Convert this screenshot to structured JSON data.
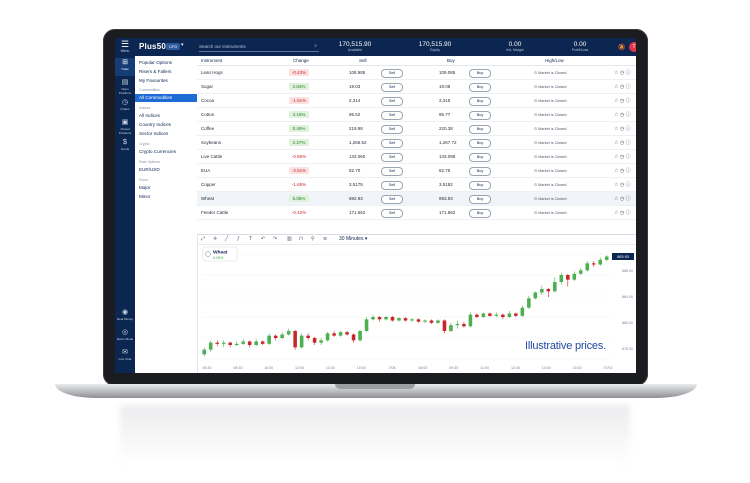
{
  "app": {
    "logo": "Plus500",
    "mode": "CFD",
    "menu_label": "Menu",
    "search_placeholder": "Search our Instruments",
    "stats": [
      {
        "value": "170,515.90",
        "label": "Available"
      },
      {
        "value": "170,515.90",
        "label": "Equity"
      },
      {
        "value": "0.00",
        "label": "Init. Margin"
      },
      {
        "value": "0.00",
        "label": "Profit/Loss"
      }
    ],
    "avatar_initial": "T"
  },
  "left_nav": [
    {
      "icon": "trade-icon",
      "label": "Trade",
      "glyph": "⊞",
      "active": true
    },
    {
      "icon": "open-positions-icon",
      "label": "Open Positions",
      "glyph": "▤",
      "active": false
    },
    {
      "icon": "orders-icon",
      "label": "Orders",
      "glyph": "◷",
      "active": false
    },
    {
      "icon": "closed-positions-icon",
      "label": "Closed Positions",
      "glyph": "▣",
      "active": false
    },
    {
      "icon": "funds-icon",
      "label": "Funds",
      "glyph": "$",
      "active": false
    }
  ],
  "left_nav_bottom": [
    {
      "icon": "real-money-icon",
      "label": "Real Money"
    },
    {
      "icon": "demo-mode-icon",
      "label": "Demo Mode"
    },
    {
      "icon": "live-chat-icon",
      "label": "Live Chat"
    }
  ],
  "categories": [
    {
      "label": "Popular Options",
      "type": "item"
    },
    {
      "label": "Risers & Fallers",
      "type": "item"
    },
    {
      "label": "My Favourites",
      "type": "item"
    },
    {
      "label": "Commodities",
      "type": "group"
    },
    {
      "label": "All Commodities",
      "type": "selected"
    },
    {
      "label": "Indices",
      "type": "group"
    },
    {
      "label": "All Indices",
      "type": "item"
    },
    {
      "label": "Country Indices",
      "type": "item"
    },
    {
      "label": "Sector Indices",
      "type": "item"
    },
    {
      "label": "Crypto",
      "type": "group"
    },
    {
      "label": "Crypto Currencies",
      "type": "item"
    },
    {
      "label": "Rate Options",
      "type": "group"
    },
    {
      "label": "EUR/USD",
      "type": "item"
    },
    {
      "label": "Forex",
      "type": "group"
    },
    {
      "label": "Major",
      "type": "item"
    },
    {
      "label": "Minor",
      "type": "item"
    }
  ],
  "table": {
    "headers": {
      "instrument": "Instrument",
      "change": "Change",
      "sell": "Sell",
      "buy": "Buy",
      "highlow": "High/Low"
    },
    "sell_label": "Sell",
    "buy_label": "Buy",
    "closed_label": "Market is Closed",
    "rows": [
      {
        "name": "Lean Hogs",
        "change": "-0.43%",
        "dir": "neg",
        "sell": "108.985",
        "buy": "109.085"
      },
      {
        "name": "Sugar",
        "change": "2.83%",
        "dir": "pos",
        "sell": "19.03",
        "buy": "19.08"
      },
      {
        "name": "Cocoa",
        "change": "-1.61%",
        "dir": "neg",
        "sell": "2,314",
        "buy": "2,315"
      },
      {
        "name": "Cotton",
        "change": "4.15%",
        "dir": "pos",
        "sell": "95.52",
        "buy": "95.77"
      },
      {
        "name": "Coffee",
        "change": "0.49%",
        "dir": "pos",
        "sell": "219.98",
        "buy": "220.38"
      },
      {
        "name": "Soybeans",
        "change": "2.27%",
        "dir": "pos",
        "sell": "1,266.52",
        "buy": "1,267.72"
      },
      {
        "name": "Live Cattle",
        "change": "-0.65%",
        "dir": "negtext",
        "sell": "133.060",
        "buy": "133.098"
      },
      {
        "name": "EUA",
        "change": "-2.51%",
        "dir": "neg",
        "sell": "82.70",
        "buy": "82.75"
      },
      {
        "name": "Copper",
        "change": "-1.65%",
        "dir": "negtext",
        "sell": "3.5175",
        "buy": "3.5182"
      },
      {
        "name": "Wheat",
        "change": "6.08%",
        "dir": "pos",
        "sell": "892.93",
        "buy": "893.93"
      },
      {
        "name": "Feeder Cattle",
        "change": "-0.42%",
        "dir": "negtext",
        "sell": "171.662",
        "buy": "171.862"
      }
    ]
  },
  "chart_toolbar": {
    "timeframe": "30 Minutes"
  },
  "chart_data": {
    "type": "candlestick",
    "title": "Wheat",
    "subtitle": "6.08%",
    "x_tick_labels": [
      "06:30",
      "08:30",
      "10:30",
      "12:00",
      "13:30",
      "15:00",
      "7/08",
      "08:00",
      "09:30",
      "11:00",
      "12:30",
      "14:00",
      "15:30",
      "07/01"
    ],
    "y_tick_labels": [
      "893.93",
      "888.00",
      "884.00",
      "880.00",
      "876.00"
    ],
    "current_price_tag": "893.93",
    "candles": [
      {
        "o": 852.0,
        "c": 854.0,
        "h": 855.0,
        "l": 851.0
      },
      {
        "o": 854.0,
        "c": 857.0,
        "h": 858.0,
        "l": 853.0
      },
      {
        "o": 857.0,
        "c": 856.5,
        "h": 858.0,
        "l": 855.5
      },
      {
        "o": 856.5,
        "c": 857.0,
        "h": 858.0,
        "l": 855.0
      },
      {
        "o": 857.0,
        "c": 856.0,
        "h": 857.5,
        "l": 855.0
      },
      {
        "o": 856.0,
        "c": 856.5,
        "h": 857.5,
        "l": 855.5
      },
      {
        "o": 856.5,
        "c": 857.5,
        "h": 858.5,
        "l": 856.0
      },
      {
        "o": 857.5,
        "c": 856.0,
        "h": 858.0,
        "l": 855.0
      },
      {
        "o": 856.0,
        "c": 857.5,
        "h": 858.5,
        "l": 855.5
      },
      {
        "o": 857.5,
        "c": 856.5,
        "h": 858.0,
        "l": 856.0
      },
      {
        "o": 856.5,
        "c": 860.0,
        "h": 861.0,
        "l": 856.0
      },
      {
        "o": 860.0,
        "c": 859.0,
        "h": 860.5,
        "l": 858.0
      },
      {
        "o": 859.0,
        "c": 860.5,
        "h": 861.5,
        "l": 858.5
      },
      {
        "o": 860.5,
        "c": 862.0,
        "h": 863.0,
        "l": 860.0
      },
      {
        "o": 862.0,
        "c": 855.0,
        "h": 862.5,
        "l": 854.0
      },
      {
        "o": 855.0,
        "c": 860.0,
        "h": 861.0,
        "l": 854.5
      },
      {
        "o": 860.0,
        "c": 859.0,
        "h": 861.0,
        "l": 858.0
      },
      {
        "o": 859.0,
        "c": 857.0,
        "h": 859.5,
        "l": 856.0
      },
      {
        "o": 857.0,
        "c": 858.0,
        "h": 859.0,
        "l": 856.0
      },
      {
        "o": 858.0,
        "c": 861.0,
        "h": 861.5,
        "l": 857.5
      },
      {
        "o": 861.0,
        "c": 860.0,
        "h": 862.0,
        "l": 859.5
      },
      {
        "o": 860.0,
        "c": 861.5,
        "h": 862.0,
        "l": 859.5
      },
      {
        "o": 861.5,
        "c": 860.5,
        "h": 862.0,
        "l": 860.0
      },
      {
        "o": 860.5,
        "c": 858.0,
        "h": 861.0,
        "l": 857.0
      },
      {
        "o": 858.0,
        "c": 862.0,
        "h": 862.5,
        "l": 857.5
      },
      {
        "o": 862.0,
        "c": 867.0,
        "h": 868.0,
        "l": 861.5
      },
      {
        "o": 867.0,
        "c": 868.0,
        "h": 869.0,
        "l": 866.5
      },
      {
        "o": 868.0,
        "c": 867.0,
        "h": 868.5,
        "l": 866.0
      },
      {
        "o": 867.0,
        "c": 868.0,
        "h": 868.5,
        "l": 866.5
      },
      {
        "o": 868.0,
        "c": 866.5,
        "h": 868.5,
        "l": 866.0
      },
      {
        "o": 866.5,
        "c": 867.5,
        "h": 868.0,
        "l": 866.0
      },
      {
        "o": 867.5,
        "c": 866.5,
        "h": 868.0,
        "l": 866.0
      },
      {
        "o": 866.5,
        "c": 867.0,
        "h": 867.5,
        "l": 866.0
      },
      {
        "o": 867.0,
        "c": 866.0,
        "h": 867.5,
        "l": 865.5
      },
      {
        "o": 866.0,
        "c": 866.5,
        "h": 867.0,
        "l": 865.5
      },
      {
        "o": 866.5,
        "c": 865.5,
        "h": 867.0,
        "l": 865.0
      },
      {
        "o": 865.5,
        "c": 866.5,
        "h": 867.0,
        "l": 865.0
      },
      {
        "o": 866.5,
        "c": 862.0,
        "h": 867.0,
        "l": 861.0
      },
      {
        "o": 862.0,
        "c": 864.5,
        "h": 865.5,
        "l": 861.5
      },
      {
        "o": 864.5,
        "c": 865.0,
        "h": 866.5,
        "l": 863.0
      },
      {
        "o": 865.0,
        "c": 864.0,
        "h": 866.0,
        "l": 863.5
      },
      {
        "o": 864.0,
        "c": 869.0,
        "h": 870.0,
        "l": 863.5
      },
      {
        "o": 869.0,
        "c": 868.0,
        "h": 869.5,
        "l": 867.5
      },
      {
        "o": 868.0,
        "c": 869.5,
        "h": 870.0,
        "l": 867.5
      },
      {
        "o": 869.5,
        "c": 868.5,
        "h": 870.0,
        "l": 868.0
      },
      {
        "o": 868.5,
        "c": 869.0,
        "h": 870.0,
        "l": 868.0
      },
      {
        "o": 869.0,
        "c": 868.0,
        "h": 869.5,
        "l": 867.0
      },
      {
        "o": 868.0,
        "c": 869.5,
        "h": 870.5,
        "l": 867.5
      },
      {
        "o": 869.5,
        "c": 868.5,
        "h": 870.0,
        "l": 868.0
      },
      {
        "o": 868.5,
        "c": 872.0,
        "h": 873.0,
        "l": 868.0
      },
      {
        "o": 872.0,
        "c": 876.0,
        "h": 877.0,
        "l": 871.5
      },
      {
        "o": 876.0,
        "c": 878.5,
        "h": 879.0,
        "l": 875.5
      },
      {
        "o": 878.5,
        "c": 880.0,
        "h": 881.5,
        "l": 877.5
      },
      {
        "o": 880.0,
        "c": 879.0,
        "h": 880.5,
        "l": 876.5
      },
      {
        "o": 879.0,
        "c": 883.0,
        "h": 885.0,
        "l": 878.5
      },
      {
        "o": 883.0,
        "c": 886.0,
        "h": 887.0,
        "l": 882.0
      },
      {
        "o": 886.0,
        "c": 884.0,
        "h": 886.5,
        "l": 881.0
      },
      {
        "o": 884.0,
        "c": 886.5,
        "h": 887.5,
        "l": 883.5
      },
      {
        "o": 886.5,
        "c": 888.0,
        "h": 889.0,
        "l": 886.0
      },
      {
        "o": 888.0,
        "c": 891.0,
        "h": 892.0,
        "l": 887.5
      },
      {
        "o": 891.0,
        "c": 890.5,
        "h": 892.0,
        "l": 889.5
      },
      {
        "o": 890.5,
        "c": 892.5,
        "h": 893.5,
        "l": 890.0
      },
      {
        "o": 892.5,
        "c": 893.93,
        "h": 894.5,
        "l": 892.0
      }
    ],
    "y_range": [
      850,
      895
    ],
    "up_color": "#4caf50",
    "down_color": "#c62828"
  },
  "overlay_text": "Illustrative prices.",
  "colors": {
    "brand": "#0b2650",
    "accent": "#1f6bd6",
    "up": "#4caf50",
    "down": "#c62828"
  }
}
